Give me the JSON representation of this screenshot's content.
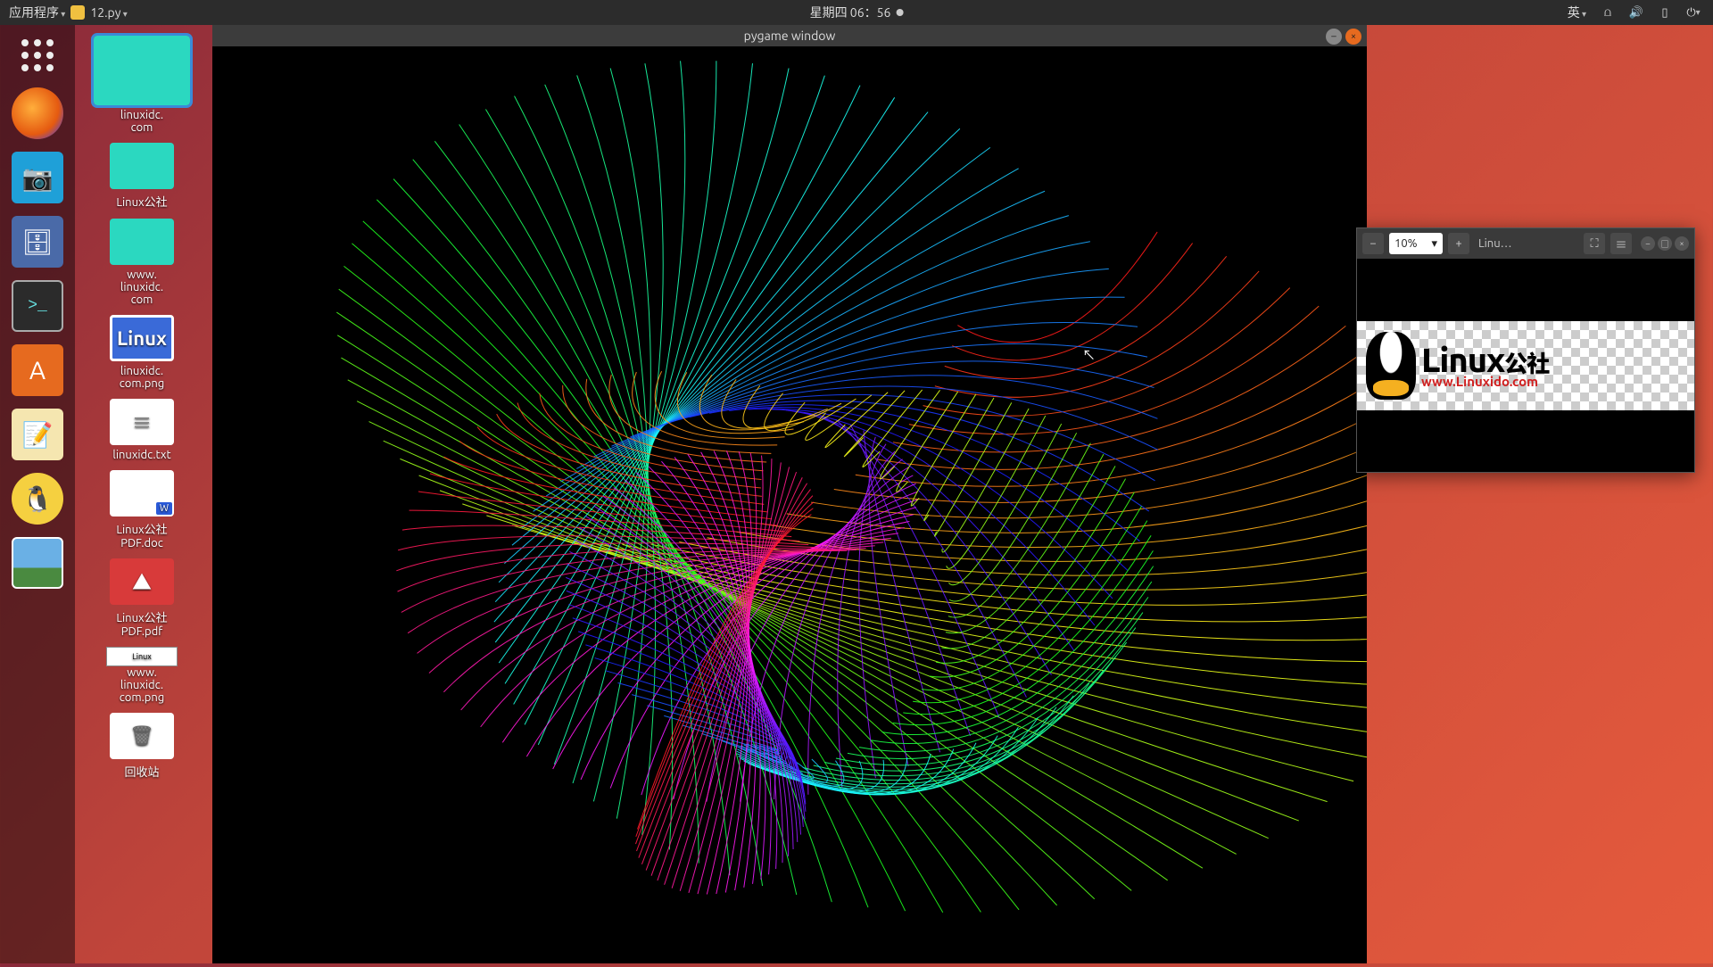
{
  "topbar": {
    "apps_label": "应用程序",
    "script_label": "12.py",
    "clock": "星期四 06：56",
    "ime": "英"
  },
  "desktop": {
    "items": [
      {
        "label": "linuxidc.\ncom",
        "type": "folder-big"
      },
      {
        "label": "Linux公社",
        "type": "folder"
      },
      {
        "label": "www.\nlinuxidc.\ncom",
        "type": "folder"
      },
      {
        "label": "linuxidc.\ncom.png",
        "type": "imgfile"
      },
      {
        "label": "linuxidc.txt",
        "type": "txtfile"
      },
      {
        "label": "Linux公社\nPDF.doc",
        "type": "docfile"
      },
      {
        "label": "Linux公社\nPDF.pdf",
        "type": "pdffile"
      },
      {
        "label": "www.\nlinuxidc.\ncom.png",
        "type": "pngstrip"
      },
      {
        "label": "回收站",
        "type": "trash"
      }
    ]
  },
  "pygame": {
    "title": "pygame window"
  },
  "viewer": {
    "zoom": "10%",
    "title": "Linu…",
    "logo_text": "Linux",
    "logo_cn": "公社",
    "logo_url": "www.Linuxido.com"
  }
}
